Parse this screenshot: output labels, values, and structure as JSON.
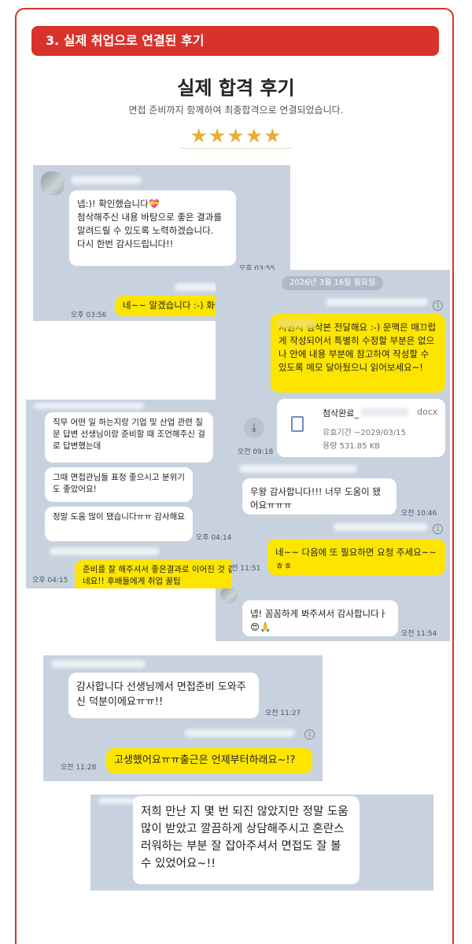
{
  "section": {
    "title": "3. 실제 취업으로 연결된 후기"
  },
  "page": {
    "title": "실제 합격 후기",
    "subtitle": "면접 준비까지 함께하여 최종합격으로 연결되었습니다.",
    "rating": {
      "stars_text": "★★★★★",
      "value": 5,
      "max": 5
    }
  },
  "chat1": {
    "msg1": "넵:)! 확인했습니다💝\n첨삭해주신 내용 바탕으로 좋은 결과를 알려드릴 수 있도록 노력하겠습니다.\n다시 한번 감사드립니다!!",
    "msg1_time": "오후 03:55",
    "reply": "네~~ 알겠습니다 :-) 화이",
    "reply_time": "오후 03:56"
  },
  "chat2": {
    "date": "2026년 3월 16일 월요일",
    "reply": "지원서 첨삭본 전달해요 :-) 문맥은 매끄럽게 작성되어서 특별히 수정할 부분은 없으나 안에 내용 부분에 참고하여 작성할 수 있도록 메모 달아뒀으니 읽어보세요~!",
    "file_name": "첨삭완료_",
    "file_ext": "docx",
    "file_expiry": "유효기간 ~2029/03/15",
    "file_size": "용량 531.85 KB",
    "file_time": "오전 09:18",
    "thanks": "우왕 감사합니다!!! 너무 도움이 됐어요ㅠㅠㅠ",
    "thanks_time": "오전 10:46",
    "reply2": "네~~ 다음에 또 필요하면 요청 주세요~~ㅎㅎ",
    "reply2_time": "오전 11:51",
    "final": "넵! 꼼꼼하게 봐주셔서 감사합니다ㅏ\n😍🙏",
    "final_time": "오전 11:54"
  },
  "chat3": {
    "msg1": "직무 어떤 일 하는지랑 기업 및 산업 관련 질문 답변 선생님이랑 준비할 때 조언해주신 걸로 답변했는데",
    "msg2": "그때 면접관님들 표정 좋으시고 분위기도 좋았어요!",
    "msg3": "정말 도움 많이 됐습니다ㅠㅠ 감사해요",
    "msg_time": "오후 04:14",
    "reply": "준비를 잘 해주셔서 좋은결과로 이어진 것 같네요!! 후배들에게 취업 꿀팁",
    "reply_time": "오후 04:15"
  },
  "chat4": {
    "msg1": "감사합니다 선생님께서 면접준비 도와주신 덕분이에요ㅠㅠ!!",
    "msg1_time": "오전 11:27",
    "reply": "고생했어요ㅠㅠ출근은 언제부터하래요~!?",
    "reply_time": "오전 11:28"
  },
  "chat5": {
    "msg1": "저희 만난 지 몇 번 되진 않았지만 정말 도움 많이 받았고 깔끔하게 상담해주시고 혼란스러워하는 부분 잘 잡아주셔서 면접도 잘 볼 수 있었어요~!!"
  }
}
